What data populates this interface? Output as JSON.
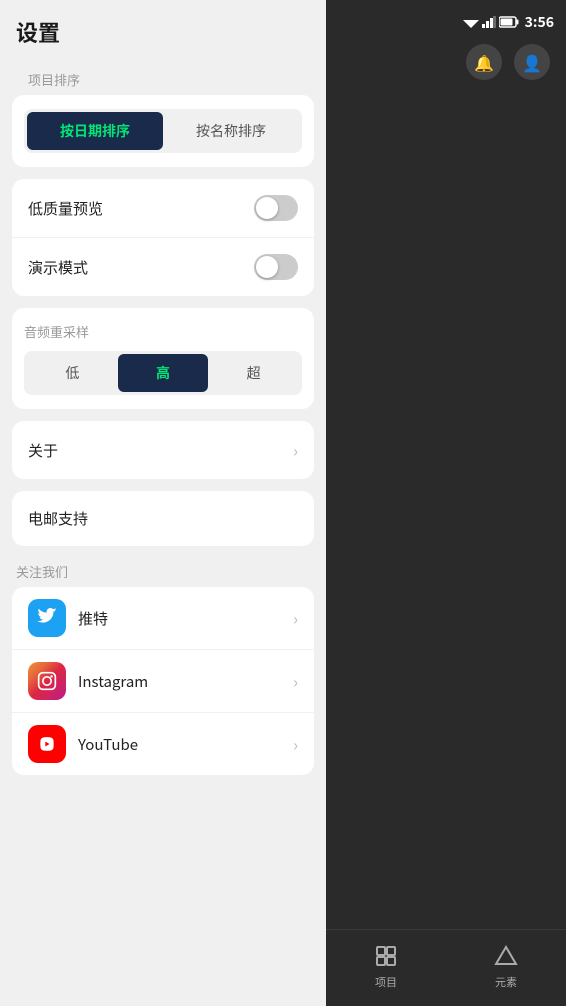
{
  "statusBar": {
    "time": "3:56"
  },
  "page": {
    "title": "设置"
  },
  "sortSection": {
    "label": "项目排序",
    "buttons": [
      {
        "id": "by-date",
        "label": "按日期排序",
        "active": true
      },
      {
        "id": "by-name",
        "label": "按名称排序",
        "active": false
      }
    ]
  },
  "toggleSection": {
    "items": [
      {
        "id": "low-quality",
        "label": "低质量预览",
        "enabled": false
      },
      {
        "id": "demo-mode",
        "label": "演示模式",
        "enabled": false
      }
    ]
  },
  "audioSection": {
    "label": "音频重采样",
    "buttons": [
      {
        "id": "low",
        "label": "低",
        "active": false
      },
      {
        "id": "high",
        "label": "高",
        "active": true
      },
      {
        "id": "ultra",
        "label": "超",
        "active": false
      }
    ]
  },
  "navSection": {
    "items": [
      {
        "id": "about",
        "label": "关于",
        "hasChevron": true
      },
      {
        "id": "email-support",
        "label": "电邮支持",
        "hasChevron": false
      }
    ]
  },
  "followSection": {
    "label": "关注我们",
    "items": [
      {
        "id": "twitter",
        "label": "推特",
        "icon": "twitter"
      },
      {
        "id": "instagram",
        "label": "Instagram",
        "icon": "instagram"
      },
      {
        "id": "youtube",
        "label": "YouTube",
        "icon": "youtube"
      }
    ]
  },
  "bottomNav": {
    "items": [
      {
        "id": "projects",
        "label": "项目",
        "icon": "⊡"
      },
      {
        "id": "elements",
        "label": "元素",
        "icon": "△"
      }
    ]
  }
}
